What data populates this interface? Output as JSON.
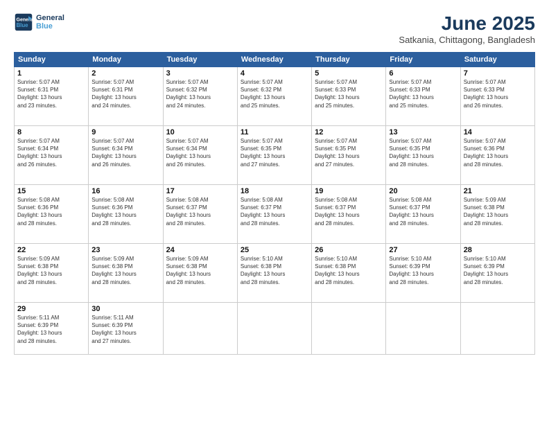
{
  "logo": {
    "line1": "General",
    "line2": "Blue"
  },
  "title": "June 2025",
  "location": "Satkania, Chittagong, Bangladesh",
  "headers": [
    "Sunday",
    "Monday",
    "Tuesday",
    "Wednesday",
    "Thursday",
    "Friday",
    "Saturday"
  ],
  "weeks": [
    [
      {
        "day": "1",
        "info": "Sunrise: 5:07 AM\nSunset: 6:31 PM\nDaylight: 13 hours\nand 23 minutes."
      },
      {
        "day": "2",
        "info": "Sunrise: 5:07 AM\nSunset: 6:31 PM\nDaylight: 13 hours\nand 24 minutes."
      },
      {
        "day": "3",
        "info": "Sunrise: 5:07 AM\nSunset: 6:32 PM\nDaylight: 13 hours\nand 24 minutes."
      },
      {
        "day": "4",
        "info": "Sunrise: 5:07 AM\nSunset: 6:32 PM\nDaylight: 13 hours\nand 25 minutes."
      },
      {
        "day": "5",
        "info": "Sunrise: 5:07 AM\nSunset: 6:33 PM\nDaylight: 13 hours\nand 25 minutes."
      },
      {
        "day": "6",
        "info": "Sunrise: 5:07 AM\nSunset: 6:33 PM\nDaylight: 13 hours\nand 25 minutes."
      },
      {
        "day": "7",
        "info": "Sunrise: 5:07 AM\nSunset: 6:33 PM\nDaylight: 13 hours\nand 26 minutes."
      }
    ],
    [
      {
        "day": "8",
        "info": "Sunrise: 5:07 AM\nSunset: 6:34 PM\nDaylight: 13 hours\nand 26 minutes."
      },
      {
        "day": "9",
        "info": "Sunrise: 5:07 AM\nSunset: 6:34 PM\nDaylight: 13 hours\nand 26 minutes."
      },
      {
        "day": "10",
        "info": "Sunrise: 5:07 AM\nSunset: 6:34 PM\nDaylight: 13 hours\nand 26 minutes."
      },
      {
        "day": "11",
        "info": "Sunrise: 5:07 AM\nSunset: 6:35 PM\nDaylight: 13 hours\nand 27 minutes."
      },
      {
        "day": "12",
        "info": "Sunrise: 5:07 AM\nSunset: 6:35 PM\nDaylight: 13 hours\nand 27 minutes."
      },
      {
        "day": "13",
        "info": "Sunrise: 5:07 AM\nSunset: 6:35 PM\nDaylight: 13 hours\nand 28 minutes."
      },
      {
        "day": "14",
        "info": "Sunrise: 5:07 AM\nSunset: 6:36 PM\nDaylight: 13 hours\nand 28 minutes."
      }
    ],
    [
      {
        "day": "15",
        "info": "Sunrise: 5:08 AM\nSunset: 6:36 PM\nDaylight: 13 hours\nand 28 minutes."
      },
      {
        "day": "16",
        "info": "Sunrise: 5:08 AM\nSunset: 6:36 PM\nDaylight: 13 hours\nand 28 minutes."
      },
      {
        "day": "17",
        "info": "Sunrise: 5:08 AM\nSunset: 6:37 PM\nDaylight: 13 hours\nand 28 minutes."
      },
      {
        "day": "18",
        "info": "Sunrise: 5:08 AM\nSunset: 6:37 PM\nDaylight: 13 hours\nand 28 minutes."
      },
      {
        "day": "19",
        "info": "Sunrise: 5:08 AM\nSunset: 6:37 PM\nDaylight: 13 hours\nand 28 minutes."
      },
      {
        "day": "20",
        "info": "Sunrise: 5:08 AM\nSunset: 6:37 PM\nDaylight: 13 hours\nand 28 minutes."
      },
      {
        "day": "21",
        "info": "Sunrise: 5:09 AM\nSunset: 6:38 PM\nDaylight: 13 hours\nand 28 minutes."
      }
    ],
    [
      {
        "day": "22",
        "info": "Sunrise: 5:09 AM\nSunset: 6:38 PM\nDaylight: 13 hours\nand 28 minutes."
      },
      {
        "day": "23",
        "info": "Sunrise: 5:09 AM\nSunset: 6:38 PM\nDaylight: 13 hours\nand 28 minutes."
      },
      {
        "day": "24",
        "info": "Sunrise: 5:09 AM\nSunset: 6:38 PM\nDaylight: 13 hours\nand 28 minutes."
      },
      {
        "day": "25",
        "info": "Sunrise: 5:10 AM\nSunset: 6:38 PM\nDaylight: 13 hours\nand 28 minutes."
      },
      {
        "day": "26",
        "info": "Sunrise: 5:10 AM\nSunset: 6:38 PM\nDaylight: 13 hours\nand 28 minutes."
      },
      {
        "day": "27",
        "info": "Sunrise: 5:10 AM\nSunset: 6:39 PM\nDaylight: 13 hours\nand 28 minutes."
      },
      {
        "day": "28",
        "info": "Sunrise: 5:10 AM\nSunset: 6:39 PM\nDaylight: 13 hours\nand 28 minutes."
      }
    ],
    [
      {
        "day": "29",
        "info": "Sunrise: 5:11 AM\nSunset: 6:39 PM\nDaylight: 13 hours\nand 28 minutes."
      },
      {
        "day": "30",
        "info": "Sunrise: 5:11 AM\nSunset: 6:39 PM\nDaylight: 13 hours\nand 27 minutes."
      },
      {
        "day": "",
        "info": ""
      },
      {
        "day": "",
        "info": ""
      },
      {
        "day": "",
        "info": ""
      },
      {
        "day": "",
        "info": ""
      },
      {
        "day": "",
        "info": ""
      }
    ]
  ]
}
